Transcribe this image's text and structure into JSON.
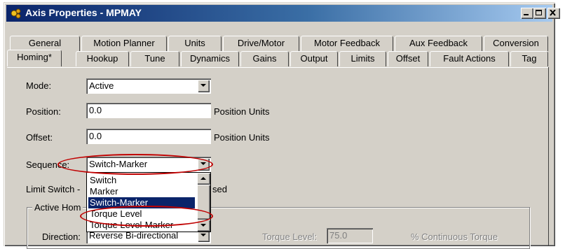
{
  "window": {
    "title": "Axis Properties - MPMAY",
    "buttons": {
      "minimize": "minimize-icon",
      "maximize": "maximize-icon",
      "close": "close-icon"
    }
  },
  "tabs": {
    "row1": [
      "General",
      "Motion Planner",
      "Units",
      "Drive/Motor",
      "Motor Feedback",
      "Aux Feedback",
      "Conversion"
    ],
    "row2": [
      "Homing*",
      "Hookup",
      "Tune",
      "Dynamics",
      "Gains",
      "Output",
      "Limits",
      "Offset",
      "Fault Actions",
      "Tag"
    ],
    "active": "Homing*"
  },
  "form": {
    "mode": {
      "label": "Mode:",
      "value": "Active"
    },
    "position": {
      "label": "Position:",
      "value": "0.0",
      "units": "Position Units"
    },
    "offset": {
      "label": "Offset:",
      "value": "0.0",
      "units": "Position Units"
    },
    "sequence": {
      "label": "Sequence:",
      "value": "Switch-Marker"
    },
    "limit_switch": {
      "label_visible": "Limit Switch -",
      "trailing_visible": "sed"
    },
    "active_home_group": {
      "title_visible": "Active Hom"
    },
    "direction": {
      "label": "Direction:",
      "value": "Reverse Bi-directional"
    },
    "torque_level": {
      "label": "Torque Level:",
      "value": "75.0",
      "units": "% Continuous Torque"
    }
  },
  "sequence_dropdown": {
    "options": [
      "Switch",
      "Marker",
      "Switch-Marker",
      "Torque Level",
      "Torque Level-Marker"
    ],
    "selected": "Switch-Marker"
  },
  "annotations": {
    "highlight_color": "#c00000"
  },
  "colors": {
    "titlebar_start": "#0a246a",
    "titlebar_end": "#a6caf0",
    "face": "#d4d0c8",
    "selection": "#0a246a"
  }
}
